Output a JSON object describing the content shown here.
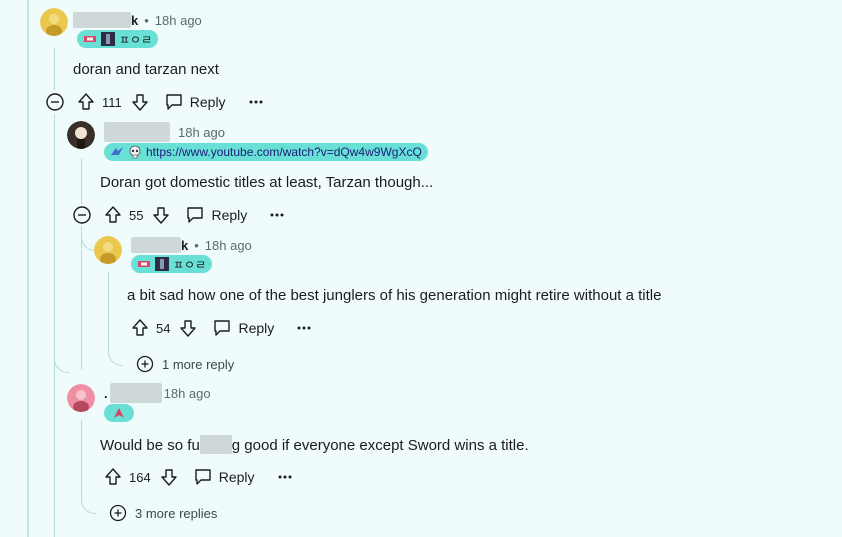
{
  "comments": [
    {
      "user_suffix": "k",
      "time": "18h ago",
      "flair_text": "ㅍㅇㄹ",
      "body": "doran and tarzan next",
      "score": "111",
      "reply_label": "Reply"
    },
    {
      "time": "18h ago",
      "flair_link": "https://www.youtube.com/watch?v=dQw4w9WgXcQ",
      "body": "Doran got domestic titles at least, Tarzan though...",
      "score": "55",
      "reply_label": "Reply"
    },
    {
      "user_suffix": "k",
      "time": "18h ago",
      "flair_text": "ㅍㅇㄹ",
      "body": "a bit sad how one of the best junglers of his generation might retire without a title",
      "score": "54",
      "reply_label": "Reply",
      "more_replies": "1 more reply"
    },
    {
      "user_prefix": ".",
      "time": "18h ago",
      "body_before": "Would be so fu",
      "body_after": "g good if everyone except Sword wins a title.",
      "score": "164",
      "reply_label": "Reply",
      "more_replies": "3 more replies"
    }
  ],
  "colors": {
    "background": "#f0fcfb",
    "flair": "#69e0d5",
    "thread_line": "#b7dbd7"
  },
  "icons": [
    "collapse-icon",
    "upvote-icon",
    "downvote-icon",
    "comment-icon",
    "more-options-icon",
    "expand-icon"
  ]
}
